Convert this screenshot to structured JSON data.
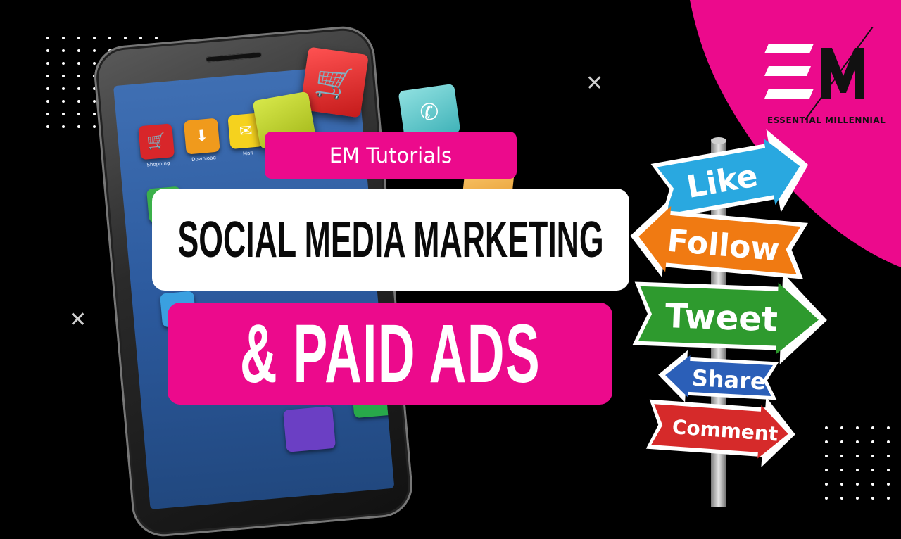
{
  "header": {
    "series_label": "EM Tutorials"
  },
  "title": {
    "line1": "SOCIAL MEDIA MARKETING",
    "line2": "& PAID ADS"
  },
  "brand": {
    "monogram": "EM",
    "name": "ESSENTIAL MILLENNIAL"
  },
  "signpost": {
    "arrows": [
      "Like",
      "Follow",
      "Tweet",
      "Share",
      "Comment"
    ]
  },
  "phone_apps": [
    {
      "label": "Shopping",
      "icon": "shopping-cart-icon"
    },
    {
      "label": "Download",
      "icon": "download-icon"
    },
    {
      "label": "Mail",
      "icon": "mail-icon"
    }
  ],
  "colors": {
    "brand_pink": "#ec0a8c",
    "background": "#000000",
    "like": "#29a8e0",
    "follow": "#f07a12",
    "tweet": "#2e9a2e",
    "share": "#2b5fb8",
    "comment": "#d62a2a"
  }
}
